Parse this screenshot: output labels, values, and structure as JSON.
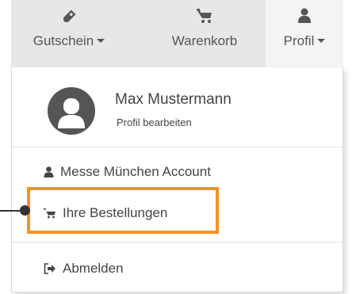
{
  "navbar": {
    "gutschein": {
      "label": "Gutschein",
      "icon": "tag-icon"
    },
    "warenkorb": {
      "label": "Warenkorb",
      "icon": "cart-icon"
    },
    "profil": {
      "label": "Profil",
      "icon": "user-icon"
    }
  },
  "profile": {
    "name": "Max Mustermann",
    "edit_label": "Profil bearbeiten",
    "avatar_icon": "user-silhouette-icon"
  },
  "menu": {
    "account_label": "Messe München Account",
    "orders_label": "Ihre Bestellungen",
    "logout_label": "Abmelden"
  },
  "colors": {
    "highlight": "#f7941d",
    "navbar_bg": "#e7e7e7",
    "avatar_bg": "#555555"
  }
}
